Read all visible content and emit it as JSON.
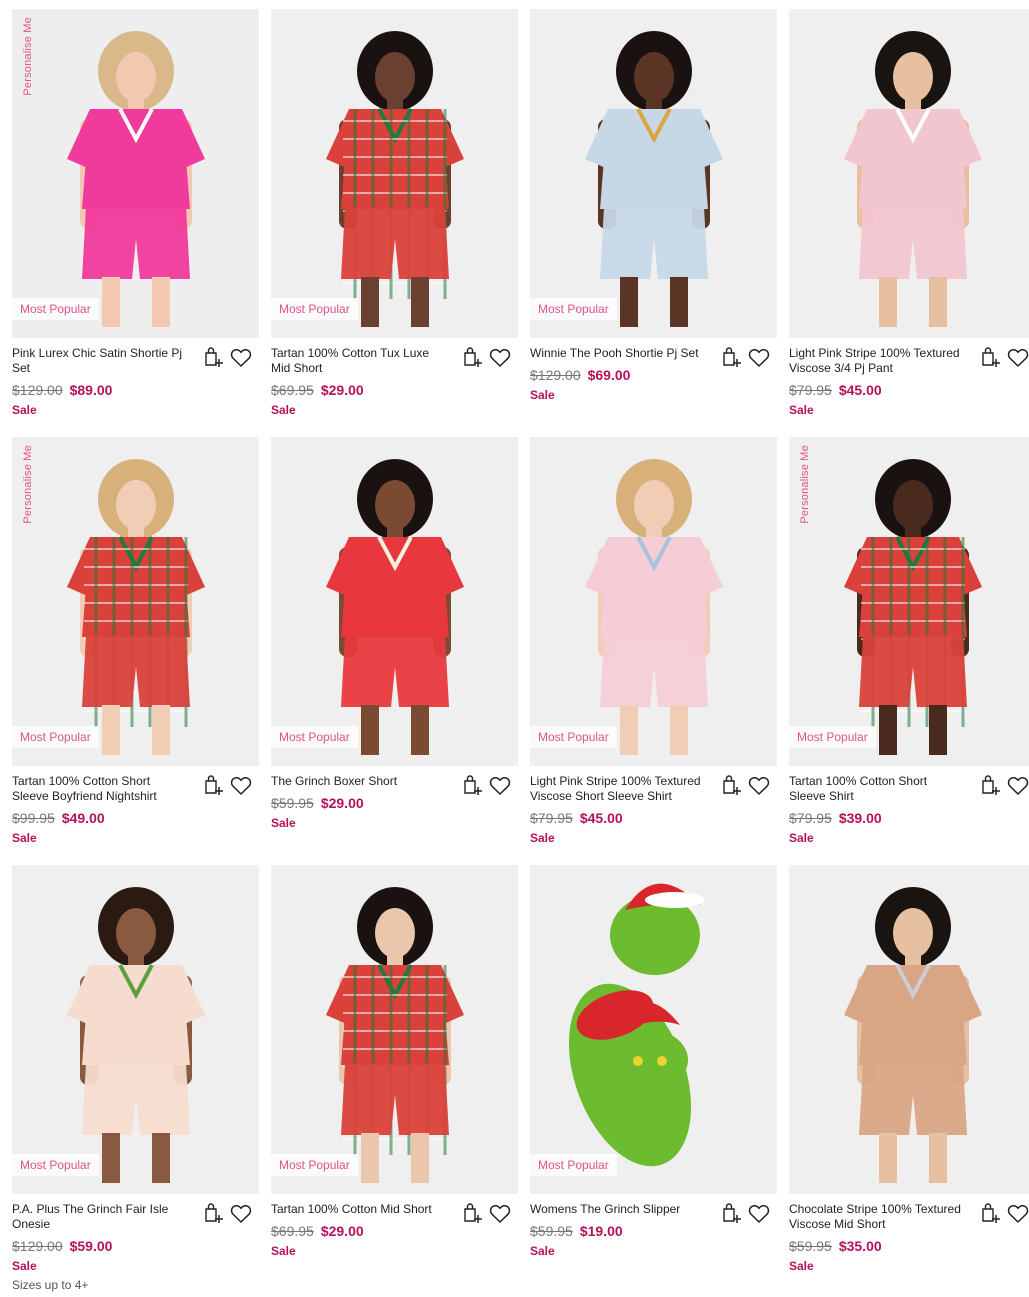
{
  "products": [
    {
      "name": "Pink Lurex Chic Satin Shortie Pj Set",
      "was": "$129.00",
      "now": "$89.00",
      "sale": "Sale",
      "badge": "Most Popular",
      "personalise": "Personalise Me",
      "sizes": "",
      "bg": "#eeeeee",
      "main": "#f03a9c",
      "accent": "#ffffff",
      "skin": "#f2c9b0",
      "hair": "#d9b98a"
    },
    {
      "name": "Tartan 100% Cotton Tux Luxe Mid Short",
      "was": "$69.95",
      "now": "$29.00",
      "sale": "Sale",
      "badge": "Most Popular",
      "personalise": "",
      "sizes": "",
      "bg": "#efefef",
      "main": "#d9413a",
      "accent": "#1f7a3c",
      "skin": "#6a4030",
      "hair": "#1a1210"
    },
    {
      "name": "Winnie The Pooh Shortie Pj Set",
      "was": "$129.00",
      "now": "$69.00",
      "sale": "Sale",
      "badge": "Most Popular",
      "personalise": "",
      "sizes": "",
      "bg": "#efefef",
      "main": "#c6d7e6",
      "accent": "#d9a640",
      "skin": "#5a3526",
      "hair": "#1a1210"
    },
    {
      "name": "Light Pink Stripe 100% Textured Viscose 3/4 Pj Pant",
      "was": "$79.95",
      "now": "$45.00",
      "sale": "Sale",
      "badge": "",
      "personalise": "",
      "sizes": "",
      "bg": "#efefef",
      "main": "#f2c6cf",
      "accent": "#ffffff",
      "skin": "#e6c0a0",
      "hair": "#1a1410"
    },
    {
      "name": "Tartan 100% Cotton Short Sleeve Boyfriend Nightshirt",
      "was": "$99.95",
      "now": "$49.00",
      "sale": "Sale",
      "badge": "Most Popular",
      "personalise": "Personalise Me",
      "sizes": "",
      "bg": "#efefef",
      "main": "#d9413a",
      "accent": "#1f7a3c",
      "skin": "#f0cdb4",
      "hair": "#d8b07a"
    },
    {
      "name": "The Grinch Boxer Short",
      "was": "$59.95",
      "now": "$29.00",
      "sale": "Sale",
      "badge": "Most Popular",
      "personalise": "",
      "sizes": "",
      "bg": "#efefef",
      "main": "#e8383d",
      "accent": "#f5f0e0",
      "skin": "#7a4a32",
      "hair": "#1a1210"
    },
    {
      "name": "Light Pink Stripe 100% Textured Viscose Short Sleeve Shirt",
      "was": "$79.95",
      "now": "$45.00",
      "sale": "Sale",
      "badge": "Most Popular",
      "personalise": "",
      "sizes": "",
      "bg": "#efefef",
      "main": "#f4cdd6",
      "accent": "#a9c3df",
      "skin": "#f0cdb4",
      "hair": "#d8b07a"
    },
    {
      "name": "Tartan 100% Cotton Short Sleeve Shirt",
      "was": "$79.95",
      "now": "$39.00",
      "sale": "Sale",
      "badge": "Most Popular",
      "personalise": "Personalise Me",
      "sizes": "",
      "bg": "#efefef",
      "main": "#d9413a",
      "accent": "#1f7a3c",
      "skin": "#4a2a1e",
      "hair": "#1a1210"
    },
    {
      "name": "P.A. Plus The Grinch Fair Isle Onesie",
      "was": "$129.00",
      "now": "$59.00",
      "sale": "Sale",
      "badge": "Most Popular",
      "personalise": "",
      "sizes": "Sizes up to 4+",
      "bg": "#efefef",
      "main": "#f5dccf",
      "accent": "#5aa040",
      "skin": "#8a5a40",
      "hair": "#2a1a12"
    },
    {
      "name": "Tartan 100% Cotton Mid Short",
      "was": "$69.95",
      "now": "$29.00",
      "sale": "Sale",
      "badge": "Most Popular",
      "personalise": "",
      "sizes": "",
      "bg": "#efefef",
      "main": "#d9413a",
      "accent": "#1f7a3c",
      "skin": "#e9c6ac",
      "hair": "#1a1210"
    },
    {
      "name": "Womens The Grinch Slipper",
      "was": "$59.95",
      "now": "$19.00",
      "sale": "Sale",
      "badge": "Most Popular",
      "personalise": "",
      "sizes": "",
      "bg": "#efefef",
      "main": "#6dbb2f",
      "accent": "#d8262c",
      "skin": "#ffffff",
      "hair": "#ffffff"
    },
    {
      "name": "Chocolate Stripe 100% Textured Viscose Mid Short",
      "was": "$59.95",
      "now": "$35.00",
      "sale": "Sale",
      "badge": "",
      "personalise": "",
      "sizes": "",
      "bg": "#efefef",
      "main": "#d8a585",
      "accent": "#c9ced8",
      "skin": "#e6c0a0",
      "hair": "#1a1410"
    }
  ],
  "icons": {
    "quick_add": "bag-plus-icon",
    "wishlist": "heart-outline-icon"
  },
  "colors": {
    "sale": "#b5125a",
    "badge": "#e0528f",
    "was": "#777777"
  }
}
